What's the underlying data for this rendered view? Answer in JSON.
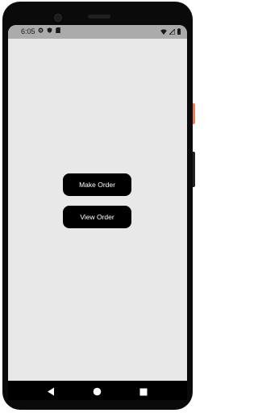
{
  "status_bar": {
    "time": "6:05",
    "left_icons": [
      "gear-icon",
      "shield-icon",
      "sd-card-icon"
    ],
    "right_icons": [
      "wifi-icon",
      "signal-icon",
      "battery-icon"
    ]
  },
  "main": {
    "make_order_label": "Make Order",
    "view_order_label": "View Order"
  },
  "nav_bar": {
    "buttons": [
      "back-icon",
      "home-icon",
      "recents-icon"
    ]
  },
  "colors": {
    "screen_bg": "#e8e8e8",
    "status_bar_bg": "#ababab",
    "button_bg": "#000000",
    "button_text": "#ffffff"
  }
}
